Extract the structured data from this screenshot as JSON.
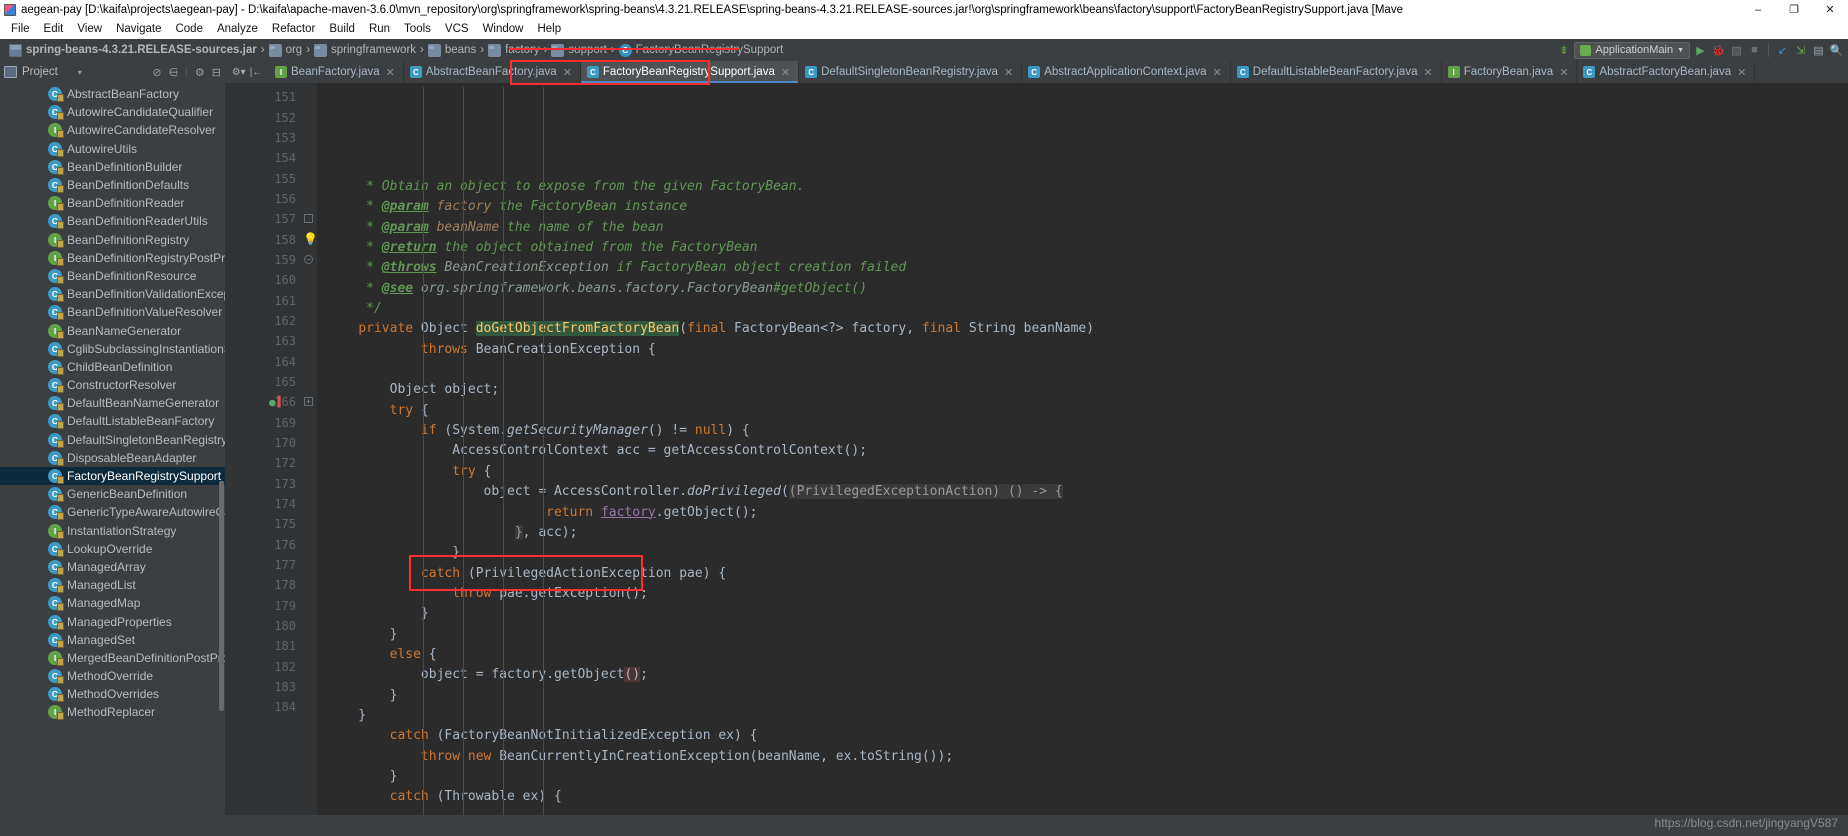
{
  "window": {
    "title": "aegean-pay [D:\\kaifa\\projects\\aegean-pay] - D:\\kaifa\\apache-maven-3.6.0\\mvn_repository\\org\\springframework\\spring-beans\\4.3.21.RELEASE\\spring-beans-4.3.21.RELEASE-sources.jar!\\org\\springframework\\beans\\factory\\support\\FactoryBeanRegistrySupport.java [Mave",
    "minimize": "–",
    "maximize": "❐",
    "close": "✕"
  },
  "menubar": {
    "items": [
      "File",
      "Edit",
      "View",
      "Navigate",
      "Code",
      "Analyze",
      "Refactor",
      "Build",
      "Run",
      "Tools",
      "VCS",
      "Window",
      "Help"
    ]
  },
  "breadcrumb": {
    "items": [
      {
        "label": "spring-beans-4.3.21.RELEASE-sources.jar",
        "icon": "jar-icon"
      },
      {
        "label": "org",
        "icon": "folder-icon"
      },
      {
        "label": "springframework",
        "icon": "folder-icon"
      },
      {
        "label": "beans",
        "icon": "folder-icon"
      },
      {
        "label": "factory",
        "icon": "folder-icon"
      },
      {
        "label": "support",
        "icon": "folder-icon"
      },
      {
        "label": "FactoryBeanRegistrySupport",
        "icon": "class-icon"
      }
    ],
    "separator": "›"
  },
  "toolbar": {
    "sort_icon": "↓∷",
    "run_config": "ApplicationMain",
    "run_config_caret": "▼",
    "run": "▶",
    "debug": "debug-icon",
    "coverage": "coverage-icon",
    "stop": "■",
    "update": "update-icon",
    "commit": "commit-icon",
    "layout": "layout-icon",
    "search": "search-icon"
  },
  "project_panel": {
    "title": "Project",
    "caret": "▾",
    "actions": [
      "collapse-icon",
      "expand-icon",
      "settings-icon",
      "hide-icon"
    ],
    "items": [
      {
        "label": "AbstractBeanFactory",
        "kind": "class"
      },
      {
        "label": "AutowireCandidateQualifier",
        "kind": "class"
      },
      {
        "label": "AutowireCandidateResolver",
        "kind": "interface"
      },
      {
        "label": "AutowireUtils",
        "kind": "class"
      },
      {
        "label": "BeanDefinitionBuilder",
        "kind": "class"
      },
      {
        "label": "BeanDefinitionDefaults",
        "kind": "class"
      },
      {
        "label": "BeanDefinitionReader",
        "kind": "interface"
      },
      {
        "label": "BeanDefinitionReaderUtils",
        "kind": "class"
      },
      {
        "label": "BeanDefinitionRegistry",
        "kind": "interface"
      },
      {
        "label": "BeanDefinitionRegistryPostProc",
        "kind": "interface"
      },
      {
        "label": "BeanDefinitionResource",
        "kind": "class"
      },
      {
        "label": "BeanDefinitionValidationExcept",
        "kind": "class"
      },
      {
        "label": "BeanDefinitionValueResolver",
        "kind": "class"
      },
      {
        "label": "BeanNameGenerator",
        "kind": "interface"
      },
      {
        "label": "CglibSubclassingInstantiationSt",
        "kind": "class"
      },
      {
        "label": "ChildBeanDefinition",
        "kind": "class"
      },
      {
        "label": "ConstructorResolver",
        "kind": "class"
      },
      {
        "label": "DefaultBeanNameGenerator",
        "kind": "class"
      },
      {
        "label": "DefaultListableBeanFactory",
        "kind": "class"
      },
      {
        "label": "DefaultSingletonBeanRegistry",
        "kind": "class"
      },
      {
        "label": "DisposableBeanAdapter",
        "kind": "class"
      },
      {
        "label": "FactoryBeanRegistrySupport",
        "kind": "class",
        "selected": true
      },
      {
        "label": "GenericBeanDefinition",
        "kind": "class"
      },
      {
        "label": "GenericTypeAwareAutowireCan",
        "kind": "class"
      },
      {
        "label": "InstantiationStrategy",
        "kind": "interface"
      },
      {
        "label": "LookupOverride",
        "kind": "class"
      },
      {
        "label": "ManagedArray",
        "kind": "class"
      },
      {
        "label": "ManagedList",
        "kind": "class"
      },
      {
        "label": "ManagedMap",
        "kind": "class"
      },
      {
        "label": "ManagedProperties",
        "kind": "class"
      },
      {
        "label": "ManagedSet",
        "kind": "class"
      },
      {
        "label": "MergedBeanDefinitionPostProc",
        "kind": "interface"
      },
      {
        "label": "MethodOverride",
        "kind": "class"
      },
      {
        "label": "MethodOverrides",
        "kind": "class"
      },
      {
        "label": "MethodReplacer",
        "kind": "interface"
      }
    ]
  },
  "editor_tabs": {
    "close_glyph": "✕",
    "tabs": [
      {
        "label": "BeanFactory.java",
        "kind": "interface",
        "active": false
      },
      {
        "label": "AbstractBeanFactory.java",
        "kind": "class",
        "active": false
      },
      {
        "label": "FactoryBeanRegistrySupport.java",
        "kind": "class",
        "active": true
      },
      {
        "label": "DefaultSingletonBeanRegistry.java",
        "kind": "class",
        "active": false
      },
      {
        "label": "AbstractApplicationContext.java",
        "kind": "class",
        "active": false
      },
      {
        "label": "DefaultListableBeanFactory.java",
        "kind": "class",
        "active": false
      },
      {
        "label": "FactoryBean.java",
        "kind": "interface",
        "active": false
      },
      {
        "label": "AbstractFactoryBean.java",
        "kind": "class",
        "active": false
      }
    ]
  },
  "code": {
    "line_numbers": [
      "151",
      "152",
      "153",
      "154",
      "155",
      "156",
      "157",
      "158",
      "159",
      "160",
      "161",
      "162",
      "163",
      "164",
      "165",
      "166",
      "169",
      "170",
      "172",
      "173",
      "174",
      "175",
      "176",
      "177",
      "178",
      "179",
      "180",
      "181",
      "182",
      "183",
      "184"
    ],
    "lines": [
      "     * Obtain an object to expose from the given FactoryBean.",
      "     * @param factory the FactoryBean instance",
      "     * @param beanName the name of the bean",
      "     * @return the object obtained from the FactoryBean",
      "     * @throws BeanCreationException if FactoryBean object creation failed",
      "     * @see org.springframework.beans.factory.FactoryBean#getObject()",
      "     */",
      "    private Object doGetObjectFromFactoryBean(final FactoryBean<?> factory, final String beanName)",
      "            throws BeanCreationException {",
      "",
      "        Object object;",
      "        try {",
      "            if (System.getSecurityManager() != null) {",
      "                AccessControlContext acc = getAccessControlContext();",
      "                try {",
      "                    object = AccessController.doPrivileged((PrivilegedExceptionAction) () -> {",
      "                            return factory.getObject();",
      "                    }, acc);",
      "                }",
      "                catch (PrivilegedActionException pae) {",
      "                    throw pae.getException();",
      "                }",
      "            }",
      "            else {",
      "                object = factory.getObject();",
      "            }",
      "        }",
      "        catch (FactoryBeanNotInitializedException ex) {",
      "            throw new BeanCurrentlyInCreationException(beanName, ex.toString());",
      "        }",
      "        catch (Throwable ex) {"
    ],
    "gutter_markers": {
      "bulb_line": "158",
      "breakpoint_line": "166",
      "breakpoint_glyph": "●"
    }
  },
  "watermark": "https://blog.csdn.net/jingyangV587",
  "colors": {
    "accent_red": "#ff2d2d",
    "editor_bg": "#2b2b2b",
    "panel_bg": "#3c3f41",
    "selection_blue": "#0d293e",
    "keyword_orange": "#cc7832",
    "comment_green": "#629755",
    "method_yellow": "#ffc66d",
    "field_purple": "#9876aa"
  }
}
